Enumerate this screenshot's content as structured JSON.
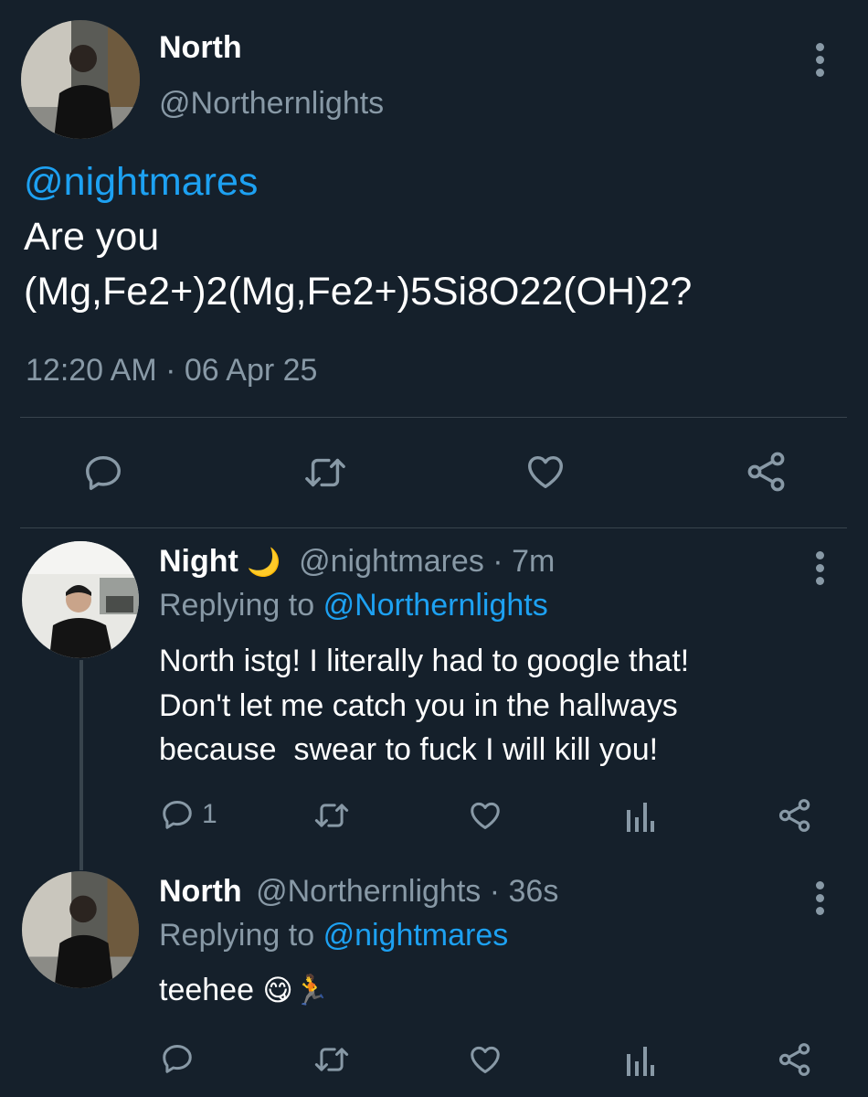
{
  "main_tweet": {
    "display_name": "North",
    "handle": "@Northernlights",
    "mention": "@nightmares",
    "text_line1": "Are you",
    "text_line2": "(Mg,Fe2+)2(Mg,Fe2+)5Si8O22(OH)2?",
    "time": "12:20 AM",
    "separator": "·",
    "date": "06 Apr 25"
  },
  "replies": [
    {
      "display_name": "Night",
      "name_emoji": "🌙",
      "handle": "@nightmares",
      "time": "· 7m",
      "replying_prefix": "Replying to",
      "replying_to": "@Northernlights",
      "lines": [
        "North istg! I literally had to google that!",
        "Don't let me catch you in the hallways",
        "because  swear to fuck I will kill you!"
      ],
      "reply_count": "1"
    },
    {
      "display_name": "North",
      "handle": "@Northernlights",
      "time": "· 36s",
      "replying_prefix": "Replying to",
      "replying_to": "@nightmares",
      "text": "teehee",
      "emojis": "😋🏃"
    }
  ],
  "icons": {
    "reply": "reply-icon",
    "retweet": "retweet-icon",
    "like": "heart-icon",
    "share": "share-icon",
    "analytics": "analytics-icon",
    "more": "more-vertical-icon"
  },
  "colors": {
    "background": "#15202b",
    "link": "#1da1f2",
    "muted": "#8899a6",
    "divider": "#38444d"
  }
}
